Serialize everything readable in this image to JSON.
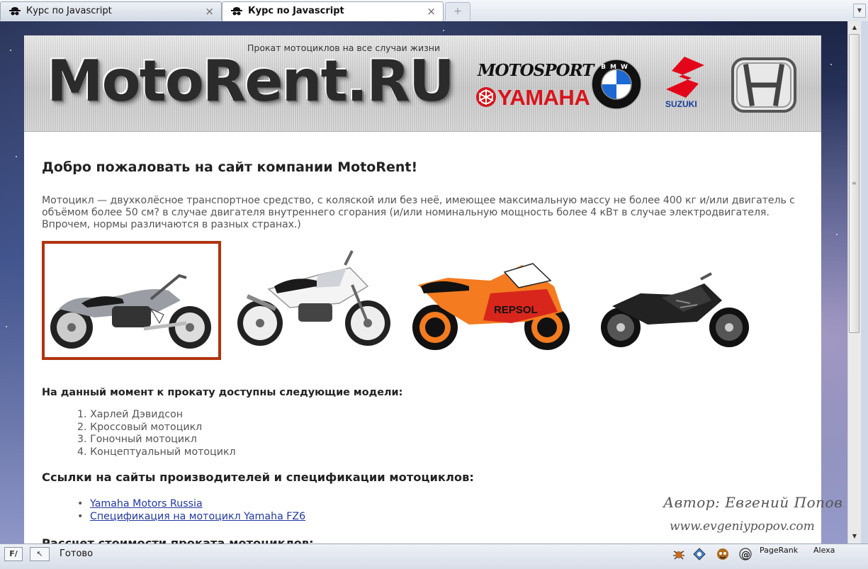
{
  "tabs": [
    {
      "label": "Курс по Javascript",
      "close": "×",
      "active": false
    },
    {
      "label": "Курс по Javascript",
      "close": "×",
      "active": true
    }
  ],
  "new_tab": "+",
  "tab_list": "▼",
  "header": {
    "tagline": "Прокат мотоциклов на все случаи жизни",
    "logo": "MotoRent.RU",
    "brands": {
      "motosport": "MOTOSPORT",
      "yamaha": "YAMAHA",
      "bmw": "BMW",
      "suzuki": "SUZUKI",
      "honda_icon": "honda-logo"
    }
  },
  "main": {
    "welcome": "Добро пожаловать на сайт компании MotoRent!",
    "intro": "Мотоцикл — двухколёсное транспортное средство, с коляской или без неё, имеющее максимальную массу не более 400 кг и/или двигатель с объёмом более 50 см? в случае двигателя внутреннего сгорания (и/или номинальную мощность более 4 кВт в случае электродвигателя. Впрочем, нормы различаются в разных странах.)",
    "gallery": [
      {
        "name": "harley-davidson",
        "selected": true
      },
      {
        "name": "cross-bike",
        "selected": false
      },
      {
        "name": "repsol-sport-bike",
        "selected": false
      },
      {
        "name": "concept-bike",
        "selected": false
      }
    ],
    "models_heading": "На данный момент к прокату доступны следующие модели:",
    "models": [
      {
        "num": "1.",
        "label": "Харлей Дэвидсон"
      },
      {
        "num": "2.",
        "label": "Кроссовый мотоцикл"
      },
      {
        "num": "3.",
        "label": "Гоночный мотоцикл"
      },
      {
        "num": "4.",
        "label": "Концептуальный мотоцикл"
      }
    ],
    "links_heading": "Ссылки на сайты производителей и спецификации мотоциклов:",
    "links": [
      {
        "bullet": "•",
        "label": "Yamaha Motors Russia"
      },
      {
        "bullet": "•",
        "label": "Спецификация на мотоцикл Yamaha FZ6"
      }
    ],
    "calc_heading": "Рассчет стоимости проката мотоциклов:"
  },
  "watermark": {
    "author": "Автор: Евгений Попов",
    "site": "www.evgeniypopov.com"
  },
  "statusbar": {
    "status": "Готово",
    "pagerank": "PageRank",
    "alexa": "Alexa"
  },
  "colors": {
    "selected_border": "#b0340f",
    "link": "#2238a0",
    "yamaha_red": "#d9141b",
    "suzuki_red": "#e3061a",
    "repsol_orange": "#f47b20"
  }
}
